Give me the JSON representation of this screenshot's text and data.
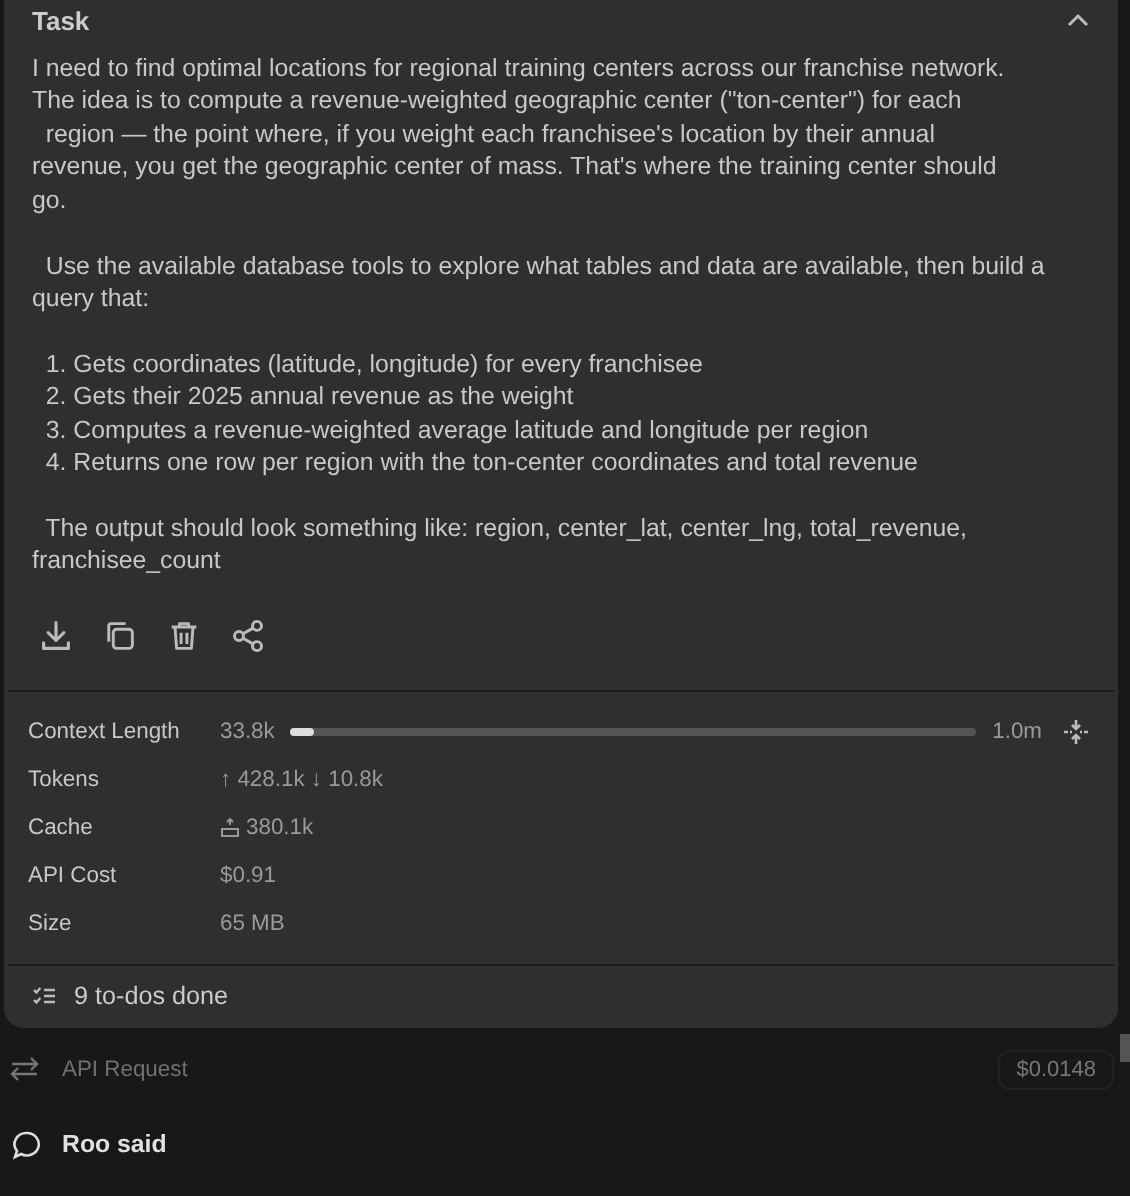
{
  "task": {
    "title": "Task",
    "expanded": true,
    "paragraphs": [
      "I need to find optimal locations for regional training centers across our franchise network.\nThe idea is to compute a revenue-weighted geographic center (\"ton-center\") for each\n  region — the point where, if you weight each franchisee's location by their annual\nrevenue, you get the geographic center of mass. That's where the training center should\ngo.",
      "  Use the available database tools to explore what tables and data are available, then build a\nquery that:",
      "  1. Gets coordinates (latitude, longitude) for every franchisee\n  2. Gets their 2025 annual revenue as the weight\n  3. Computes a revenue-weighted average latitude and longitude per region\n  4. Returns one row per region with the ton-center coordinates and total revenue",
      "  The output should look something like: region, center_lat, center_lng, total_revenue,\nfranchisee_count"
    ]
  },
  "actions": [
    {
      "kind": "download"
    },
    {
      "kind": "copy"
    },
    {
      "kind": "delete"
    },
    {
      "kind": "share"
    }
  ],
  "context": {
    "label": "Context Length",
    "used": "33.8k",
    "level": 0.034,
    "max": "1.0m"
  },
  "stats": [
    {
      "label": "Tokens",
      "value": "↑ 428.1k ↓ 10.8k"
    },
    {
      "label": "Cache",
      "value": "380.1k",
      "kind": "cache"
    },
    {
      "label": "API Cost",
      "value": "$0.91"
    },
    {
      "label": "Size",
      "value": "65 MB"
    }
  ],
  "todos": "9 to-dos done",
  "api_request": {
    "label": "API Request",
    "cost": "$0.0148"
  },
  "roo": {
    "label": "Roo said"
  }
}
